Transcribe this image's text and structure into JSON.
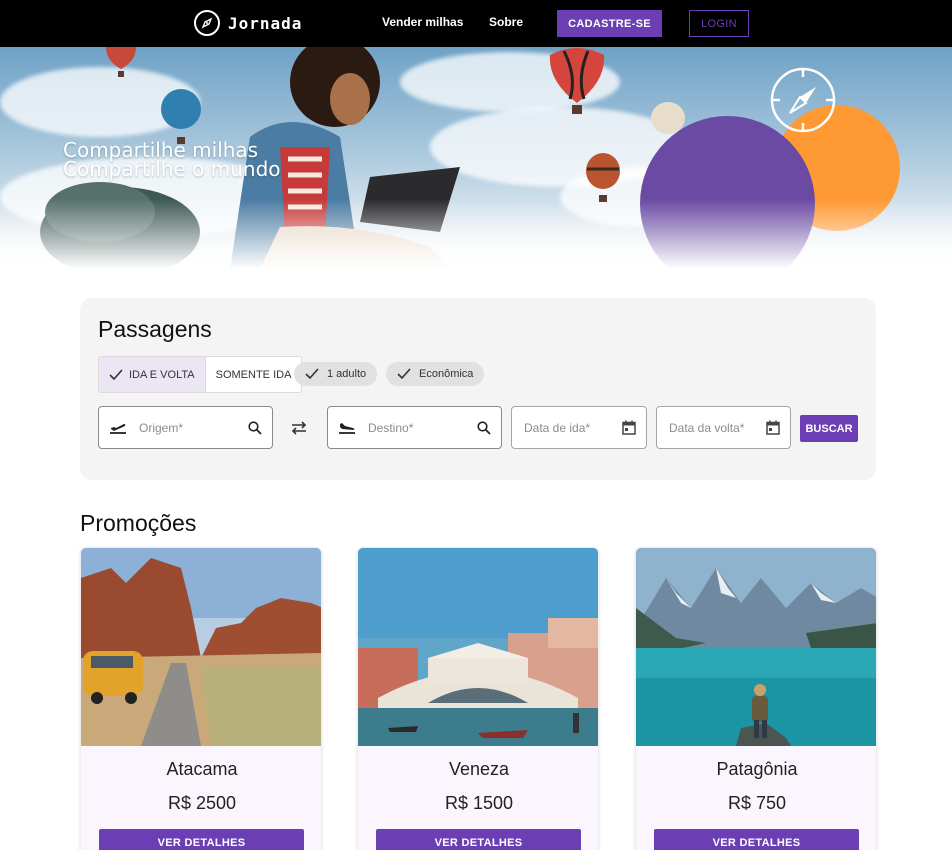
{
  "nav": {
    "brand": "Jornada",
    "links": [
      "Vender milhas",
      "Sobre"
    ],
    "signup_label": "CADASTRE-SE",
    "login_label": "LOGIN"
  },
  "hero": {
    "line1": "Compartilhe milhas",
    "line2": "Compartilhe o mundo"
  },
  "search": {
    "title": "Passagens",
    "trip_types": [
      {
        "label": "IDA E VOLTA",
        "selected": true
      },
      {
        "label": "SOMENTE IDA",
        "selected": false
      }
    ],
    "passengers": "1 adulto",
    "cabin": "Econômica",
    "origin_placeholder": "Origem*",
    "destination_placeholder": "Destino*",
    "departure_placeholder": "Data de ida*",
    "return_placeholder": "Data da volta*",
    "search_label": "BUSCAR"
  },
  "promo": {
    "title": "Promoções",
    "cards": [
      {
        "name": "Atacama",
        "price": "R$ 2500",
        "button": "VER DETALHES"
      },
      {
        "name": "Veneza",
        "price": "R$ 1500",
        "button": "VER DETALHES"
      },
      {
        "name": "Patagônia",
        "price": "R$ 750",
        "button": "VER DETALHES"
      }
    ]
  },
  "colors": {
    "accent": "#6b3fb3",
    "hero_purple": "#6a4aa3",
    "hero_orange": "#ff9933",
    "nav_bg": "#000000"
  }
}
